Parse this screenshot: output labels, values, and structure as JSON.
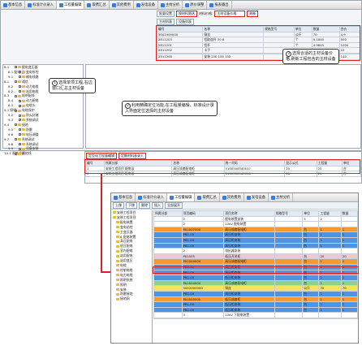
{
  "top_tabs": [
    "基本信息",
    "标准计价录入",
    "工程量编辑",
    "取费汇总",
    "其他费用",
    "发电设备",
    "主材分析",
    "原价调整",
    "报表输出"
  ],
  "top_toolbar": {
    "filter": "批量设置",
    "hl_btn": "按材料筛选",
    "label": "材料价格:",
    "select": "主材设备价格",
    "refresh": "刷新"
  },
  "top_subtabs": [
    "主材列表",
    "设备列表"
  ],
  "top_table": {
    "headers": [
      "编号",
      "名称",
      "规格型号",
      "单位",
      "数量",
      "合价"
    ],
    "rows": [
      [
        "5002000000",
        "铜丝",
        "",
        "公斤",
        "70",
        "4,9"
      ],
      [
        "2811203",
        "铝取连杆 30 6",
        "",
        "个",
        "9.1840",
        "500"
      ],
      [
        "2811201",
        "铝杆",
        "",
        "个",
        "4.9845",
        "1000"
      ],
      [
        "2811202",
        "卡子",
        "",
        "个",
        "1.2346",
        "12"
      ],
      [
        "",
        "",
        "",
        "",
        "",
        ""
      ],
      [
        "2911200",
        "安装 250 100 152",
        "",
        "个",
        "1.3450",
        "140"
      ]
    ]
  },
  "top_tree": {
    "items": [
      "8.1",
      "8.1 配电 变",
      "9.1",
      "8.1",
      "8.2",
      "8.2",
      "8.3",
      "8.4",
      "8.5",
      "9.1 照明",
      "9.2",
      "9.3",
      "9.4",
      "9.5",
      "9.6",
      "9.7",
      "9.8",
      "9.9",
      "10.1 系统调试"
    ],
    "labels": [
      "配电变压器",
      "变电所控",
      "输电线路",
      "通信",
      "动力电缆",
      "站用电缆",
      "照明配线",
      "动力配电",
      "电缆头",
      "电缆保护",
      "防火封堵",
      "系统调试",
      "接地",
      "防雷",
      "电压调整",
      "系统调试",
      "系统调试",
      "设备安装",
      "接地线"
    ]
  },
  "mid_tabs": [
    "定型化工程量编辑",
    "定额材料表录入"
  ],
  "mid_table": {
    "headers": [
      "编号",
      "所属分部",
      "名称",
      "统一代码",
      "显示公式",
      "工程量",
      "单位"
    ],
    "rows": [
      [
        "1",
        "安装工程项目 配电设",
        "高压成套配电柜",
        "5100500040017",
        "20",
        "25",
        "台"
      ],
      [
        "2",
        "安装工程项目 配电设",
        "高压成套配电柜",
        "5100500040010",
        "20",
        "25",
        "台"
      ]
    ]
  },
  "win_tabs": [
    "基本信息",
    "标准计价录入",
    "工程量编辑",
    "取费汇总",
    "其他费用",
    "发电设备",
    "主材分析"
  ],
  "win_toolbar": [
    "上移",
    "下移",
    "删除",
    "插入",
    "全部展开"
  ],
  "win_tree": [
    "安装工程项目",
    "安装工程项目",
    "配电装置",
    "变电站控",
    "主变压器",
    "6 配电装置",
    "高压配电",
    "低压配电",
    "室内配电",
    "站用配电",
    "站用变压",
    "电缆",
    "控制电缆",
    "电力电缆",
    "照明系统",
    "照明",
    "安装",
    "防雷接地",
    "接地网"
  ],
  "win_table": {
    "headers": [
      "所属分部",
      "项目编码",
      "项目名称",
      "规格型号",
      "单位",
      "工程量",
      "数量"
    ],
    "rows": [
      {
        "c": "r-white",
        "v": [
          "",
          "2",
          "配电装置安装",
          "",
          "5",
          "2",
          ""
        ]
      },
      {
        "c": "r-white",
        "v": [
          "",
          "2",
          "10kV 配电装置",
          "",
          "",
          "",
          ""
        ]
      },
      {
        "c": "r-orange",
        "v": [
          "",
          "PA1007000",
          "高压成套配电柜",
          "",
          "台",
          "1",
          "1"
        ]
      },
      {
        "c": "r-blue",
        "v": [
          "",
          "PB1-00",
          "高压柜安装",
          "",
          "台",
          "1",
          "1"
        ]
      },
      {
        "c": "r-blue",
        "v": [
          "",
          "PB1-00",
          "高压柜安装",
          "",
          "台",
          "1",
          "1"
        ]
      },
      {
        "c": "r-blue",
        "v": [
          "",
          "PB1-00",
          "高压柜安装",
          "",
          "台",
          "1",
          "1"
        ]
      },
      {
        "c": "r-white",
        "v": [
          "",
          "2",
          "电抗器安装",
          "",
          "",
          "",
          ""
        ]
      },
      {
        "c": "r-sel",
        "v": [
          "",
          "PA1005",
          "低压开关柜",
          "",
          "台",
          "20",
          "20"
        ]
      },
      {
        "c": "r-orange",
        "v": [
          "",
          "PA1004000",
          "高压成套配电柜",
          "",
          "台",
          "1",
          "1"
        ]
      },
      {
        "c": "r-blue",
        "v": [
          "",
          "PB1-00",
          "高压柜安装",
          "",
          "台",
          "1",
          "1"
        ]
      },
      {
        "c": "r-blue",
        "v": [
          "",
          "PB1-00",
          "高压柜安装",
          "",
          "台",
          "1",
          "1"
        ]
      },
      {
        "c": "r-blue",
        "v": [
          "",
          "PB1-00",
          "低压柜安装",
          "",
          "台",
          "1",
          "1"
        ]
      },
      {
        "c": "r-green",
        "v": [
          "",
          "PA1004000",
          "高压成套配电柜",
          "",
          "台",
          "1",
          "1"
        ]
      },
      {
        "c": "r-yellow",
        "v": [
          "",
          "5002000000",
          "铜丝",
          "",
          "公斤",
          "70",
          "70"
        ]
      },
      {
        "c": "r-blue",
        "v": [
          "",
          "PB1-00",
          "高压柜安装",
          "",
          "台",
          "1",
          "1"
        ]
      },
      {
        "c": "r-orange",
        "v": [
          "",
          "PA1005000",
          "低压成套柜",
          "",
          "台",
          "1",
          "1"
        ]
      },
      {
        "c": "r-blue",
        "v": [
          "",
          "PB1-00",
          "低压柜安装",
          "",
          "台",
          "1",
          "1"
        ]
      },
      {
        "c": "r-blue",
        "v": [
          "",
          "PB1-00",
          "低压柜安装",
          "",
          "台",
          "1",
          "1"
        ]
      },
      {
        "c": "r-white",
        "v": [
          "",
          "3",
          "10kV 下配电装置",
          "",
          "",
          "",
          ""
        ]
      },
      {
        "c": "r-white",
        "v": [
          "",
          "",
          "",
          "",
          "",
          "",
          ""
        ]
      }
    ]
  },
  "callouts": {
    "c1": {
      "num": "1",
      "text": "选择单项工程,右边窗口汇总主材设备"
    },
    "c2": {
      "num": "2",
      "text": "利用精确定位功能,在工程量编辑、标准设计录入界面定位选择的主材设备"
    },
    "c3": {
      "num": "3",
      "text": "选择合适的主材设备价格,刷新工程包含的主材设备"
    }
  }
}
